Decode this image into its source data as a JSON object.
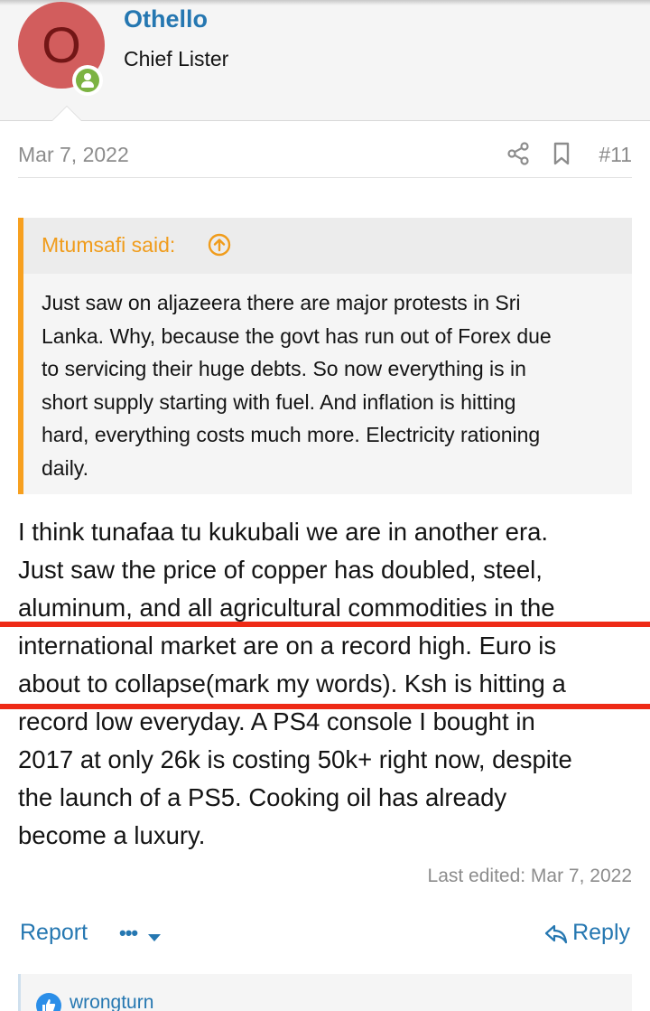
{
  "post": {
    "author": {
      "avatar_letter": "O",
      "username": "Othello",
      "title": "Chief Lister",
      "online": true
    },
    "date": "Mar 7, 2022",
    "number": "#11",
    "quote": {
      "author": "Mtumsafi said:",
      "lines": [
        "Just saw on aljazeera there are major protests in Sri",
        "Lanka. Why, because the govt has run out of Forex due",
        "to servicing their huge debts. So now everything is in",
        "short supply starting with fuel. And inflation is hitting",
        "hard, everything costs much more. Electricity rationing",
        "daily."
      ]
    },
    "body_lines": [
      "I think tunafaa tu kukubali we are in another era.",
      "Just saw the price of copper has doubled, steel,",
      "aluminum, and all agricultural commodities in the",
      "international market are on a record high. Euro is",
      "about to collapse(mark my words). Ksh is hitting a",
      "record low everyday. A PS4 console I bought in",
      "2017 at only 26k is costing 50k+ right now, despite",
      "the launch of a PS5. Cooking oil has already",
      "become a luxury."
    ],
    "last_edited": "Last edited: Mar 7, 2022",
    "actions": {
      "report": "Report",
      "more": "•••",
      "reply": "Reply"
    },
    "reactions": {
      "user": "wrongturn"
    }
  },
  "colors": {
    "link": "#2577b1",
    "quote_accent": "#f7a01f",
    "avatar_bg": "#d25d5d",
    "online": "#7cb342",
    "highlight_line": "#ee2a16"
  },
  "icons": [
    "share-icon",
    "bookmark-icon",
    "arrow-up-circle-icon",
    "chevron-down-icon",
    "reply-icon",
    "like-icon",
    "user-icon"
  ]
}
